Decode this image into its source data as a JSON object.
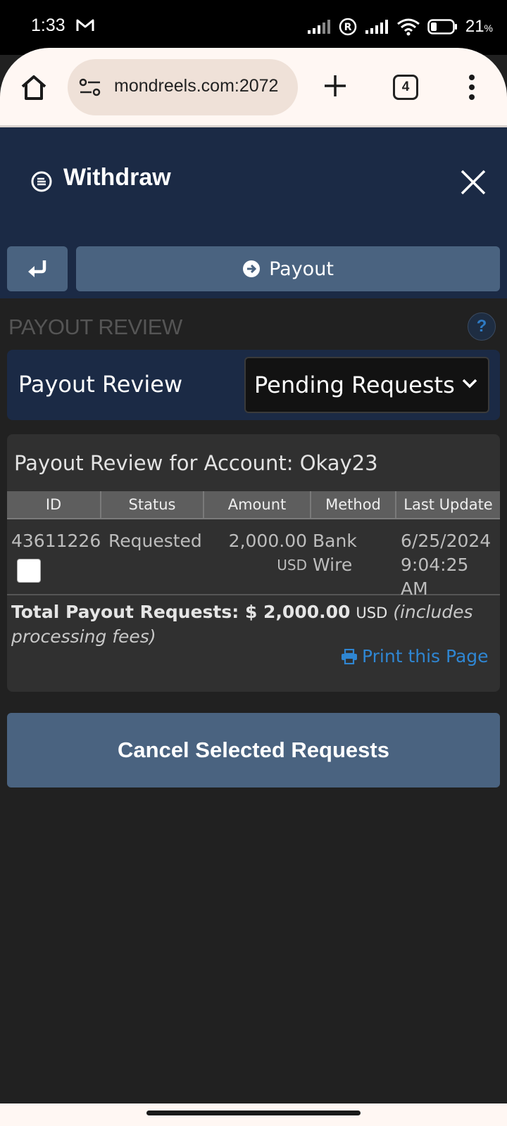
{
  "status_bar": {
    "time": "1:33",
    "battery_pct": "21",
    "battery_unit": "%"
  },
  "browser": {
    "url": "mondreels.com:2072",
    "tab_count": "4"
  },
  "modal": {
    "title": "Withdraw",
    "payout_button": "Payout"
  },
  "section": {
    "title": "PAYOUT REVIEW",
    "help": "?"
  },
  "review_bar": {
    "label": "Payout Review",
    "filter_selected": "Pending Requests"
  },
  "panel": {
    "title": "Payout Review for Account: Okay23",
    "columns": [
      "ID",
      "Status",
      "Amount",
      "Method",
      "Last Update"
    ],
    "rows": [
      {
        "id": "43611226",
        "status": "Requested",
        "amount": "2,000.00",
        "currency": "USD",
        "method_line1": "Bank",
        "method_line2": "Wire",
        "date": "6/25/2024",
        "time": "9:04:25 AM",
        "selected": false
      }
    ],
    "total_label": "Total Payout Requests: $ 2,000.00",
    "total_currency": "USD",
    "total_note": "(includes processing fees)",
    "print_label": "Print this Page"
  },
  "actions": {
    "cancel_label": "Cancel Selected Requests"
  },
  "colors": {
    "header_bg": "#1b2a45",
    "button_bg": "#4a6380",
    "page_bg": "#212121",
    "panel_bg": "#303030",
    "link": "#2f86d2"
  }
}
